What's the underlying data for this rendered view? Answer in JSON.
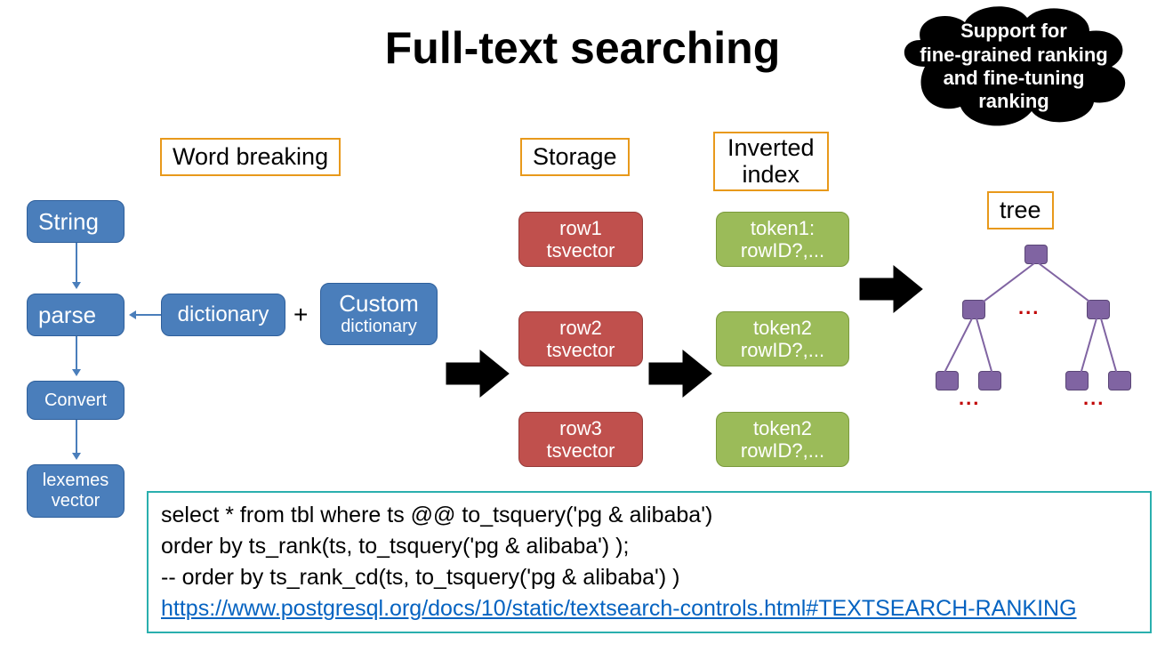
{
  "title": "Full-text searching",
  "labels": {
    "word_breaking": "Word breaking",
    "storage": "Storage",
    "inverted_index": "Inverted\nindex",
    "tree": "tree"
  },
  "pipeline": {
    "string": "String",
    "parse": "parse",
    "convert": "Convert",
    "lexemes_l1": "lexemes",
    "lexemes_l2": "vector",
    "dictionary": "dictionary",
    "custom_l1": "Custom",
    "custom_l2": "dictionary",
    "plus": "+"
  },
  "storage": {
    "row1_l1": "row1",
    "row1_l2": "tsvector",
    "row2_l1": "row2",
    "row2_l2": "tsvector",
    "row3_l1": "row3",
    "row3_l2": "tsvector"
  },
  "index": {
    "t1_l1": "token1:",
    "t1_l2": "rowID?,...",
    "t2_l1": "token2",
    "t2_l2": "rowID?,...",
    "t3_l1": "token2",
    "t3_l2": "rowID?,..."
  },
  "cloud": "Support for\nfine-grained ranking\nand fine-tuning\nranking",
  "code": {
    "l1": "select * from tbl where ts @@ to_tsquery('pg & alibaba')",
    "l2": " order by ts_rank(ts, to_tsquery('pg & alibaba') );",
    "l3": " -- order by ts_rank_cd(ts, to_tsquery('pg & alibaba') )",
    "link": "https://www.postgresql.org/docs/10/static/textsearch-controls.html#TEXTSEARCH-RANKING"
  },
  "dots": "..."
}
